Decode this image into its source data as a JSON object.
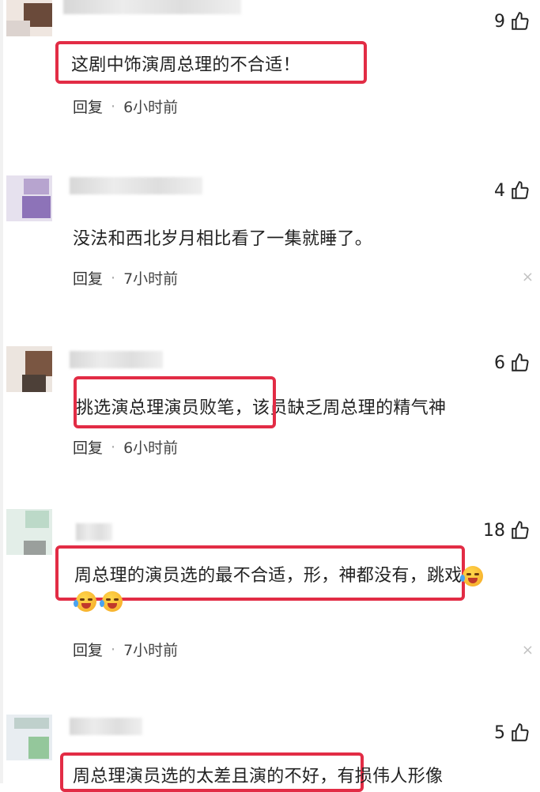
{
  "comments": [
    {
      "likes": "9",
      "text": "这剧中饰演周总理的不合适！",
      "reply": "回复",
      "dot": "·",
      "time": "6小时前",
      "close": ""
    },
    {
      "likes": "4",
      "text": "没法和西北岁月相比看了一集就睡了。",
      "reply": "回复",
      "dot": "·",
      "time": "7小时前",
      "close": "×"
    },
    {
      "likes": "6",
      "text": "挑选演总理演员败笔，该员缺乏周总理的精气神",
      "reply": "回复",
      "dot": "·",
      "time": "6小时前",
      "close": ""
    },
    {
      "likes": "18",
      "text": "周总理的演员选的最不合适，形，神都没有，跳戏",
      "reply": "回复",
      "dot": "·",
      "time": "7小时前",
      "close": "×"
    },
    {
      "likes": "5",
      "text": "周总理演员选的太差且演的不好，有损伟人形像"
    }
  ],
  "icons": {
    "like": "thumbs-up-icon",
    "emoji": "crying-laughing-emoji-icon",
    "close": "close-icon"
  },
  "colors": {
    "highlight": "#e22c45"
  }
}
